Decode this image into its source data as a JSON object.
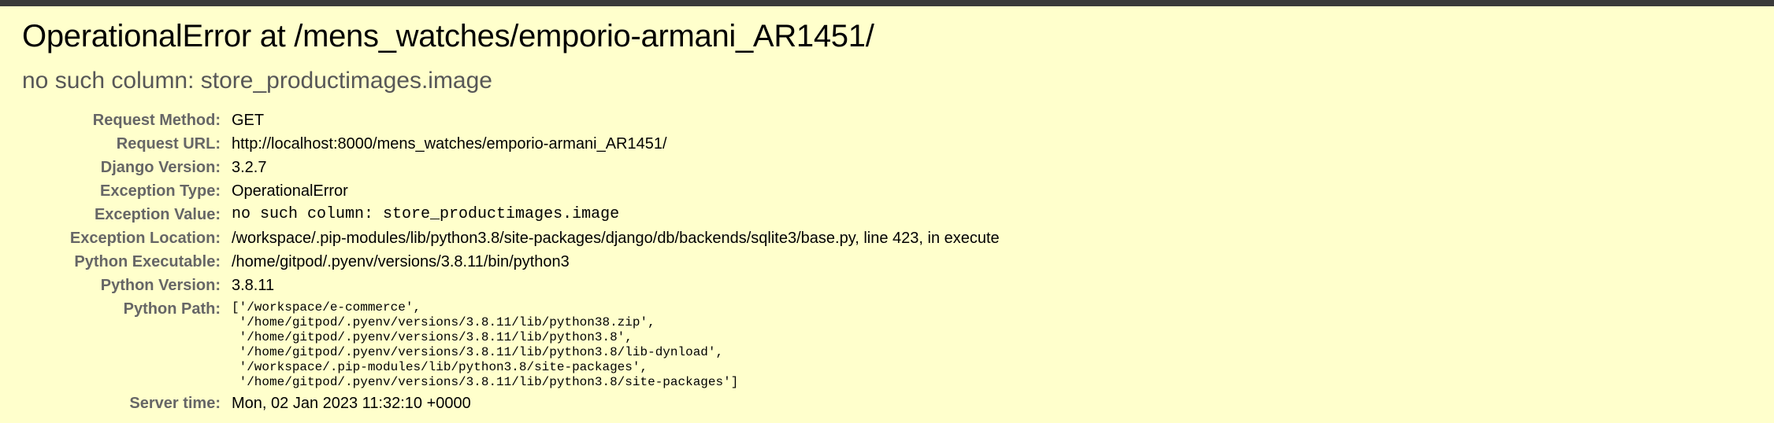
{
  "error": {
    "title": "OperationalError at /mens_watches/emporio-armani_AR1451/",
    "message": "no such column: store_productimages.image"
  },
  "meta": {
    "request_method": {
      "label": "Request Method:",
      "value": "GET"
    },
    "request_url": {
      "label": "Request URL:",
      "value": "http://localhost:8000/mens_watches/emporio-armani_AR1451/"
    },
    "django_version": {
      "label": "Django Version:",
      "value": "3.2.7"
    },
    "exception_type": {
      "label": "Exception Type:",
      "value": "OperationalError"
    },
    "exception_value": {
      "label": "Exception Value:",
      "value": "no such column: store_productimages.image"
    },
    "exception_location": {
      "label": "Exception Location:",
      "value": "/workspace/.pip-modules/lib/python3.8/site-packages/django/db/backends/sqlite3/base.py, line 423, in execute"
    },
    "python_executable": {
      "label": "Python Executable:",
      "value": "/home/gitpod/.pyenv/versions/3.8.11/bin/python3"
    },
    "python_version": {
      "label": "Python Version:",
      "value": "3.8.11"
    },
    "python_path": {
      "label": "Python Path:",
      "value": "['/workspace/e-commerce',\n '/home/gitpod/.pyenv/versions/3.8.11/lib/python38.zip',\n '/home/gitpod/.pyenv/versions/3.8.11/lib/python3.8',\n '/home/gitpod/.pyenv/versions/3.8.11/lib/python3.8/lib-dynload',\n '/workspace/.pip-modules/lib/python3.8/site-packages',\n '/home/gitpod/.pyenv/versions/3.8.11/lib/python3.8/site-packages']"
    },
    "server_time": {
      "label": "Server time:",
      "value": "Mon, 02 Jan 2023 11:32:10 +0000"
    }
  },
  "colors": {
    "background": "#ffffcc",
    "top_bar": "#3a3a3a",
    "label": "#666666",
    "subtitle": "#575757"
  }
}
